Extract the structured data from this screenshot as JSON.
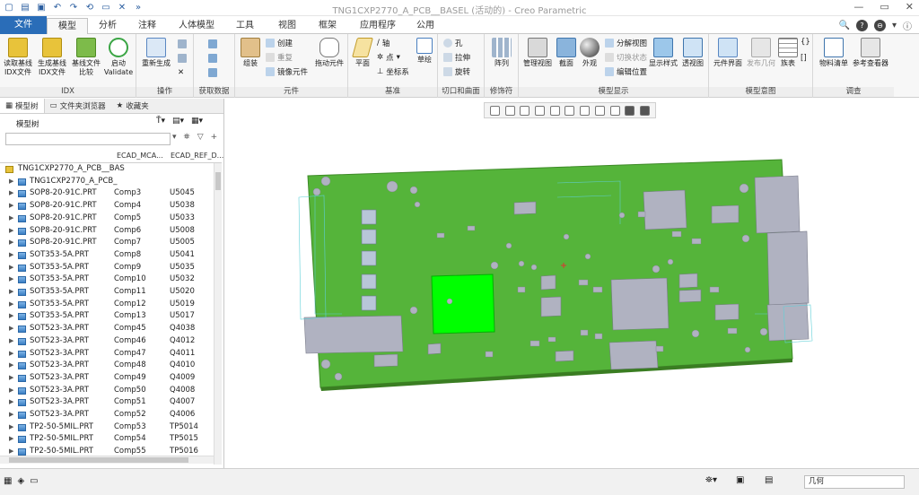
{
  "window": {
    "title": "TNG1CXP2770_A_PCB__BASEL (活动的) - Creo Parametric"
  },
  "tabs": [
    "文件",
    "模型",
    "分析",
    "注释",
    "人体模型",
    "工具",
    "视图",
    "框架",
    "应用程序",
    "公用"
  ],
  "ribbon": {
    "idx": {
      "label": "IDX",
      "btn1": "读取基线",
      "btn1b": "IDX文件",
      "btn2": "生成基线",
      "btn2b": "IDX文件",
      "btn3": "基线文件",
      "btn3b": "比较",
      "btn4": "启动",
      "btn4b": "Validate"
    },
    "ops": {
      "label": "操作",
      "regen": "重新生成"
    },
    "getdata": {
      "label": "获取数据"
    },
    "comp": {
      "label": "元件",
      "assemble": "组装",
      "create": "创建",
      "repeat": "重复",
      "mirror": "镜像元件",
      "drag": "拖动元件"
    },
    "datum": {
      "label": "基准",
      "plane": "平面",
      "axis": "轴",
      "point": "点",
      "csys": "坐标系",
      "sketch": "草绘"
    },
    "cut": {
      "label": "切口和曲面",
      "hole": "孔",
      "extrude": "拉伸",
      "revolve": "旋转"
    },
    "modify": {
      "label": "修饰符",
      "pattern": "阵列"
    },
    "display": {
      "label": "模型显示",
      "manage": "管理视图",
      "section": "截面",
      "appearance": "外观",
      "explode": "分解视图",
      "toggle": "切换状态",
      "editpos": "编辑位置",
      "style": "显示样式",
      "persp": "透视图"
    },
    "intent": {
      "label": "模型意图",
      "ui": "元件界面",
      "pubgeom": "发布几何",
      "table": "族表"
    },
    "investigate": {
      "label": "调查",
      "bom": "物料清单",
      "ref": "参考查看器"
    }
  },
  "panel": {
    "tabs": [
      "模型树",
      "文件夹浏览器",
      "收藏夹"
    ],
    "tree_label": "模型树",
    "col1": "ECAD_MCA...",
    "col2": "ECAD_REF_D...",
    "root": "TNG1CXP2770_A_PCB__BAS",
    "rows": [
      {
        "n": "TNG1CXP2770_A_PCB_",
        "c1": "",
        "c2": ""
      },
      {
        "n": "SOP8-20-91C.PRT",
        "c1": "Comp3",
        "c2": "U5045"
      },
      {
        "n": "SOP8-20-91C.PRT",
        "c1": "Comp4",
        "c2": "U5038"
      },
      {
        "n": "SOP8-20-91C.PRT",
        "c1": "Comp5",
        "c2": "U5033"
      },
      {
        "n": "SOP8-20-91C.PRT",
        "c1": "Comp6",
        "c2": "U5008"
      },
      {
        "n": "SOP8-20-91C.PRT",
        "c1": "Comp7",
        "c2": "U5005"
      },
      {
        "n": "SOT353-5A.PRT",
        "c1": "Comp8",
        "c2": "U5041"
      },
      {
        "n": "SOT353-5A.PRT",
        "c1": "Comp9",
        "c2": "U5035"
      },
      {
        "n": "SOT353-5A.PRT",
        "c1": "Comp10",
        "c2": "U5032"
      },
      {
        "n": "SOT353-5A.PRT",
        "c1": "Comp11",
        "c2": "U5020"
      },
      {
        "n": "SOT353-5A.PRT",
        "c1": "Comp12",
        "c2": "U5019"
      },
      {
        "n": "SOT353-5A.PRT",
        "c1": "Comp13",
        "c2": "U5017"
      },
      {
        "n": "SOT523-3A.PRT",
        "c1": "Comp45",
        "c2": "Q4038"
      },
      {
        "n": "SOT523-3A.PRT",
        "c1": "Comp46",
        "c2": "Q4012"
      },
      {
        "n": "SOT523-3A.PRT",
        "c1": "Comp47",
        "c2": "Q4011"
      },
      {
        "n": "SOT523-3A.PRT",
        "c1": "Comp48",
        "c2": "Q4010"
      },
      {
        "n": "SOT523-3A.PRT",
        "c1": "Comp49",
        "c2": "Q4009"
      },
      {
        "n": "SOT523-3A.PRT",
        "c1": "Comp50",
        "c2": "Q4008"
      },
      {
        "n": "SOT523-3A.PRT",
        "c1": "Comp51",
        "c2": "Q4007"
      },
      {
        "n": "SOT523-3A.PRT",
        "c1": "Comp52",
        "c2": "Q4006"
      },
      {
        "n": "TP2-50-5MIL.PRT",
        "c1": "Comp53",
        "c2": "TP5014"
      },
      {
        "n": "TP2-50-5MIL.PRT",
        "c1": "Comp54",
        "c2": "TP5015"
      },
      {
        "n": "TP2-50-5MIL.PRT",
        "c1": "Comp55",
        "c2": "TP5016"
      }
    ]
  },
  "status": {
    "filter": "几何"
  },
  "colors": {
    "board": "#55b43a",
    "chip": "#b0b2c1",
    "highlight": "#00ff00",
    "accent": "#2a6db8"
  }
}
